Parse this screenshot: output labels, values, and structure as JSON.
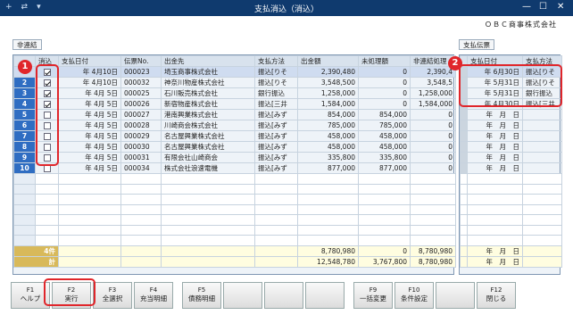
{
  "window": {
    "title": "支払消込（消込）",
    "icons": [
      "+",
      "⇄",
      "▾"
    ],
    "controls": [
      "—",
      "☐",
      "✕"
    ]
  },
  "company": "ＯＢＣ商事株式会社",
  "tags": {
    "left": "非連結",
    "right": "支払伝票"
  },
  "left_grid": {
    "headers": [
      "",
      "消込",
      "支払日付",
      "伝票No.",
      "出金先",
      "支払方法",
      "出金額",
      "未処理額",
      "非連結処理"
    ],
    "rows": [
      {
        "no": "1",
        "checked": true,
        "date": "年 4月10日",
        "slip": "000023",
        "payee": "埼玉商事株式会社",
        "method": "振込[りそ",
        "amount": "2,390,480",
        "unproc": "0",
        "nonlink": "2,390,4"
      },
      {
        "no": "2",
        "checked": true,
        "date": "年 4月10日",
        "slip": "000032",
        "payee": "神奈川物産株式会社",
        "method": "振込[りそ",
        "amount": "3,548,500",
        "unproc": "0",
        "nonlink": "3,548,5"
      },
      {
        "no": "3",
        "checked": true,
        "date": "年 4月 5日",
        "slip": "000025",
        "payee": "石川販売株式会社",
        "method": "銀行振込",
        "amount": "1,258,000",
        "unproc": "0",
        "nonlink": "1,258,000"
      },
      {
        "no": "4",
        "checked": true,
        "date": "年 4月 5日",
        "slip": "000026",
        "payee": "新宿物産株式会社",
        "method": "振込[三井",
        "amount": "1,584,000",
        "unproc": "0",
        "nonlink": "1,584,000"
      },
      {
        "no": "5",
        "checked": false,
        "date": "年 4月 5日",
        "slip": "000027",
        "payee": "港南興業株式会社",
        "method": "振込[みず",
        "amount": "854,000",
        "unproc": "854,000",
        "nonlink": "0"
      },
      {
        "no": "6",
        "checked": false,
        "date": "年 4月 5日",
        "slip": "000028",
        "payee": "川崎商会株式会社",
        "method": "振込[みず",
        "amount": "785,000",
        "unproc": "785,000",
        "nonlink": "0"
      },
      {
        "no": "7",
        "checked": false,
        "date": "年 4月 5日",
        "slip": "000029",
        "payee": "名古屋興業株式会社",
        "method": "振込[みず",
        "amount": "458,000",
        "unproc": "458,000",
        "nonlink": "0"
      },
      {
        "no": "8",
        "checked": false,
        "date": "年 4月 5日",
        "slip": "000030",
        "payee": "名古屋興業株式会社",
        "method": "振込[みず",
        "amount": "458,000",
        "unproc": "458,000",
        "nonlink": "0"
      },
      {
        "no": "9",
        "checked": false,
        "date": "年 4月 5日",
        "slip": "000031",
        "payee": "有限会社山崎商会",
        "method": "振込[みず",
        "amount": "335,800",
        "unproc": "335,800",
        "nonlink": "0"
      },
      {
        "no": "10",
        "checked": false,
        "date": "年 4月 5日",
        "slip": "000034",
        "payee": "株式会社浪速電機",
        "method": "振込[みず",
        "amount": "877,000",
        "unproc": "877,000",
        "nonlink": "0"
      }
    ],
    "sum_rows": [
      {
        "label": "4件",
        "amount": "8,780,980",
        "unproc": "0",
        "nonlink": "8,780,980"
      },
      {
        "label": "計",
        "amount": "12,548,780",
        "unproc": "3,767,800",
        "nonlink": "8,780,980"
      }
    ]
  },
  "right_grid": {
    "headers": [
      "支払日付",
      "支払方法"
    ],
    "rows": [
      {
        "date": "年 6月30日",
        "method": "振込[りそ"
      },
      {
        "date": "年 5月31日",
        "method": "振込[りそ"
      },
      {
        "date": "年 5月31日",
        "method": "銀行振込"
      },
      {
        "date": "年 4月30日",
        "method": "振込[三井"
      },
      {
        "date": "年　月　日",
        "method": ""
      },
      {
        "date": "年　月　日",
        "method": ""
      },
      {
        "date": "年　月　日",
        "method": ""
      },
      {
        "date": "年　月　日",
        "method": ""
      },
      {
        "date": "年　月　日",
        "method": ""
      },
      {
        "date": "年　月　日",
        "method": ""
      }
    ],
    "sum_rows": [
      {
        "date": "年　月　日"
      },
      {
        "date": "年　月　日"
      }
    ]
  },
  "badges": [
    "1",
    "2"
  ],
  "fkeys": [
    {
      "key": "F1",
      "label": "ヘルプ"
    },
    {
      "key": "F2",
      "label": "実行"
    },
    {
      "key": "F3",
      "label": "全選択"
    },
    {
      "key": "F4",
      "label": "充当明細"
    },
    {
      "key": "F5",
      "label": "債務明細"
    },
    {
      "key": "",
      "label": ""
    },
    {
      "key": "",
      "label": ""
    },
    {
      "key": "",
      "label": ""
    },
    {
      "key": "F9",
      "label": "一括変更"
    },
    {
      "key": "F10",
      "label": "条件設定"
    },
    {
      "key": "",
      "label": ""
    },
    {
      "key": "F12",
      "label": "閉じる"
    }
  ],
  "colors": {
    "accent": "#2f6dc2",
    "highlight": "#e0262b",
    "titlebar": "#0f3a6e"
  }
}
